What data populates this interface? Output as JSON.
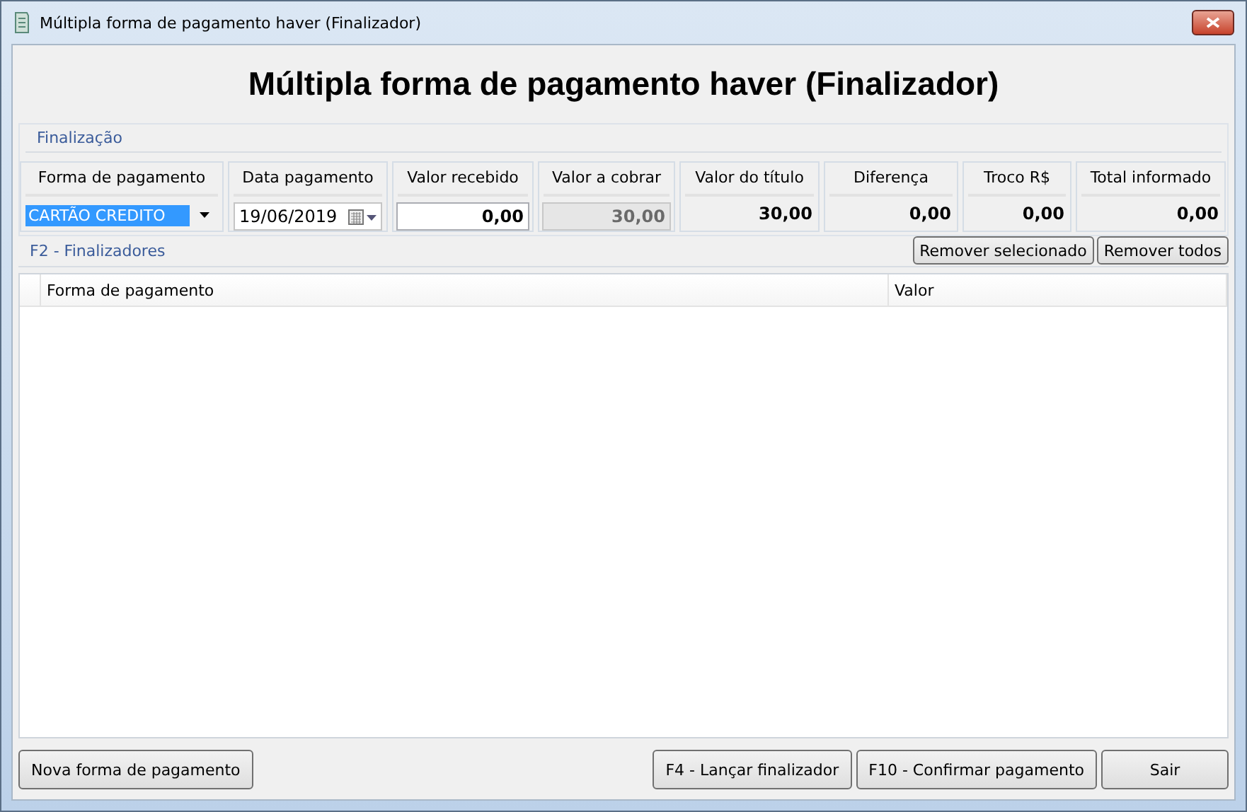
{
  "window": {
    "title": "Múltipla forma de pagamento haver (Finalizador)"
  },
  "heading": "Múltipla forma de pagamento haver (Finalizador)",
  "finalizacao": {
    "title": "Finalização",
    "fields": [
      {
        "label": "Forma de pagamento",
        "kind": "combo",
        "value": "CARTÃO CREDITO",
        "selected": true
      },
      {
        "label": "Data pagamento",
        "kind": "date",
        "value": "19/06/2019"
      },
      {
        "label": "Valor recebido",
        "kind": "input",
        "value": "0,00",
        "disabled": false
      },
      {
        "label": "Valor a cobrar",
        "kind": "input",
        "value": "30,00",
        "disabled": true
      },
      {
        "label": "Valor do título",
        "kind": "readout",
        "value": "30,00"
      },
      {
        "label": "Diferença",
        "kind": "readout",
        "value": "0,00"
      },
      {
        "label": "Troco R$",
        "kind": "readout",
        "value": "0,00"
      },
      {
        "label": "Total informado",
        "kind": "readout",
        "value": "0,00"
      }
    ]
  },
  "finalizadores": {
    "title": "F2 - Finalizadores",
    "buttons": [
      "Remover selecionado",
      "Remover todos"
    ],
    "table": {
      "columns": [
        "Forma de pagamento",
        "Valor"
      ]
    }
  },
  "footer": {
    "left_button": "Nova forma de pagamento",
    "buttons": [
      "F4 - Lançar finalizador",
      "F10 - Confirmar pagamento",
      "Sair"
    ]
  }
}
